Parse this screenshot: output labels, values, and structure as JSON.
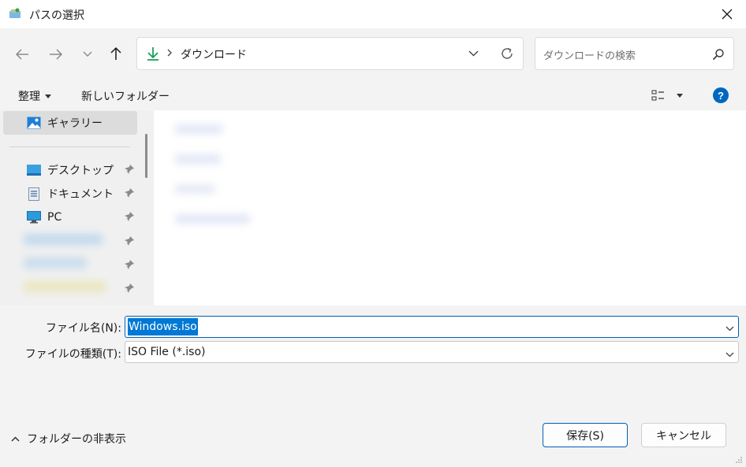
{
  "window": {
    "title": "パスの選択"
  },
  "nav": {
    "path_segment": "ダウンロード",
    "search_placeholder": "ダウンロードの検索"
  },
  "toolbar": {
    "organize_label": "整理",
    "new_folder_label": "新しいフォルダー"
  },
  "sidebar": {
    "items": [
      {
        "label": "ギャラリー",
        "icon": "gallery-icon"
      },
      {
        "label": "デスクトップ",
        "icon": "desktop-icon"
      },
      {
        "label": "ドキュメント",
        "icon": "document-icon"
      },
      {
        "label": "PC",
        "icon": "pc-icon"
      }
    ]
  },
  "form": {
    "filename_label": "ファイル名(N):",
    "filename_value": "Windows.iso",
    "filetype_label": "ファイルの種類(T):",
    "filetype_value": "ISO File (*.iso)"
  },
  "footer": {
    "hide_folders_label": "フォルダーの非表示",
    "save_label": "保存(S)",
    "cancel_label": "キャンセル"
  },
  "colors": {
    "accent": "#005fb8",
    "download_green": "#1e9e5b",
    "help_blue": "#0067c0"
  }
}
